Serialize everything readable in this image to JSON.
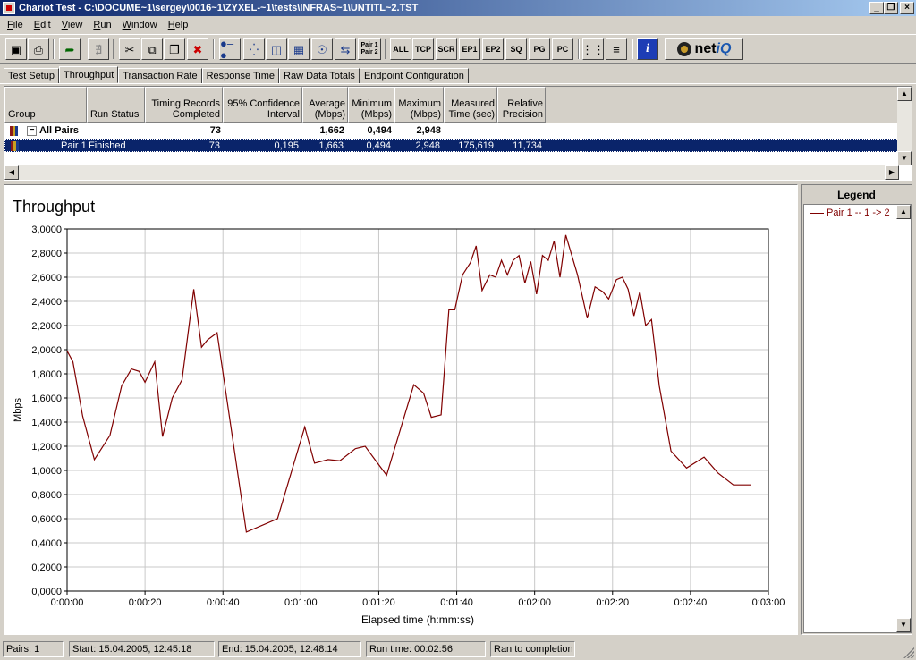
{
  "window": {
    "title": "Chariot Test - C:\\DOCUME~1\\sergey\\0016~1\\ZYXEL-~1\\tests\\INFRAS~1\\UNTITL~2.TST",
    "minimize_label": "_",
    "restore_label": "❐",
    "close_label": "×"
  },
  "menu": [
    {
      "label": "File",
      "key": "F",
      "rest": "ile"
    },
    {
      "label": "Edit",
      "key": "E",
      "rest": "dit"
    },
    {
      "label": "View",
      "key": "V",
      "rest": "iew"
    },
    {
      "label": "Run",
      "key": "R",
      "rest": "un"
    },
    {
      "label": "Window",
      "key": "W",
      "rest": "indow"
    },
    {
      "label": "Help",
      "key": "H",
      "rest": "elp"
    }
  ],
  "toolbar": {
    "save_icon": "save-icon",
    "print_icon": "print-icon",
    "run_icon": "run-icon",
    "pair_label_top": "Pair 1",
    "pair_label_bottom": "Pair 2",
    "all_label": "ALL",
    "tcp_label": "TCP",
    "scr_label": "SCR",
    "ep1_label": "EP1",
    "ep2_label": "EP2",
    "sq_label": "SQ",
    "pg_label": "PG",
    "pc_label": "PC",
    "info_label": "i",
    "brand_net": "net",
    "brand_iq": "iQ"
  },
  "tabs": [
    {
      "label": "Test Setup",
      "active": false
    },
    {
      "label": "Throughput",
      "active": true
    },
    {
      "label": "Transaction Rate",
      "active": false
    },
    {
      "label": "Response Time",
      "active": false
    },
    {
      "label": "Raw Data Totals",
      "active": false
    },
    {
      "label": "Endpoint Configuration",
      "active": false
    }
  ],
  "grid": {
    "headers": {
      "group": "Group",
      "run_status": "Run Status",
      "timing_records": "Timing Records Completed",
      "confidence": "95% Confidence Interval",
      "average": "Average (Mbps)",
      "minimum": "Minimum (Mbps)",
      "maximum": "Maximum (Mbps)",
      "measured_time": "Measured Time (sec)",
      "relative_precision": "Relative Precision"
    },
    "all_pairs": {
      "expander": "−",
      "group": "All Pairs",
      "timing_records": "73",
      "average": "1,662",
      "minimum": "0,494",
      "maximum": "2,948"
    },
    "pair1": {
      "group": "Pair 1",
      "run_status": "Finished",
      "timing_records": "73",
      "confidence": "0,195",
      "average": "1,663",
      "minimum": "0,494",
      "maximum": "2,948",
      "measured_time": "175,619",
      "relative_precision": "11,734"
    }
  },
  "chart": {
    "title": "Throughput",
    "legend_title": "Legend",
    "legend_entry": "Pair 1 -- 1 -> 2"
  },
  "chart_data": {
    "type": "line",
    "title": "Throughput",
    "xlabel": "Elapsed time (h:mm:ss)",
    "ylabel": "Mbps",
    "xlim": [
      0,
      180
    ],
    "ylim": [
      0,
      3
    ],
    "grid": true,
    "legend_placement": "right",
    "x_ticks": [
      {
        "v": 0,
        "label": "0:00:00"
      },
      {
        "v": 20,
        "label": "0:00:20"
      },
      {
        "v": 40,
        "label": "0:00:40"
      },
      {
        "v": 60,
        "label": "0:01:00"
      },
      {
        "v": 80,
        "label": "0:01:20"
      },
      {
        "v": 100,
        "label": "0:01:40"
      },
      {
        "v": 120,
        "label": "0:02:00"
      },
      {
        "v": 140,
        "label": "0:02:20"
      },
      {
        "v": 160,
        "label": "0:02:40"
      },
      {
        "v": 180,
        "label": "0:03:00"
      }
    ],
    "y_ticks": [
      {
        "v": 0,
        "label": "0,0000"
      },
      {
        "v": 0.2,
        "label": "0,2000"
      },
      {
        "v": 0.4,
        "label": "0,4000"
      },
      {
        "v": 0.6,
        "label": "0,6000"
      },
      {
        "v": 0.8,
        "label": "0,8000"
      },
      {
        "v": 1.0,
        "label": "1,0000"
      },
      {
        "v": 1.2,
        "label": "1,2000"
      },
      {
        "v": 1.4,
        "label": "1,4000"
      },
      {
        "v": 1.6,
        "label": "1,6000"
      },
      {
        "v": 1.8,
        "label": "1,8000"
      },
      {
        "v": 2.0,
        "label": "2,0000"
      },
      {
        "v": 2.2,
        "label": "2,2000"
      },
      {
        "v": 2.4,
        "label": "2,4000"
      },
      {
        "v": 2.6,
        "label": "2,6000"
      },
      {
        "v": 2.8,
        "label": "2,8000"
      },
      {
        "v": 3.0,
        "label": "3,0000"
      }
    ],
    "series": [
      {
        "name": "Pair 1 -- 1 -> 2",
        "color": "#800000",
        "points": [
          [
            0,
            1.99
          ],
          [
            1.5,
            1.9
          ],
          [
            4,
            1.45
          ],
          [
            7,
            1.09
          ],
          [
            11,
            1.29
          ],
          [
            14,
            1.7
          ],
          [
            16.5,
            1.84
          ],
          [
            18.5,
            1.82
          ],
          [
            20,
            1.73
          ],
          [
            22.5,
            1.9
          ],
          [
            24.5,
            1.28
          ],
          [
            27,
            1.6
          ],
          [
            29.5,
            1.75
          ],
          [
            32.5,
            2.5
          ],
          [
            34.5,
            2.02
          ],
          [
            36,
            2.08
          ],
          [
            38.5,
            2.14
          ],
          [
            46,
            0.49
          ],
          [
            54,
            0.6
          ],
          [
            61,
            1.36
          ],
          [
            63.5,
            1.06
          ],
          [
            67,
            1.09
          ],
          [
            70,
            1.08
          ],
          [
            74,
            1.18
          ],
          [
            76.5,
            1.2
          ],
          [
            79,
            1.09
          ],
          [
            82,
            0.96
          ],
          [
            89,
            1.71
          ],
          [
            91.5,
            1.64
          ],
          [
            93.5,
            1.44
          ],
          [
            96,
            1.46
          ],
          [
            98,
            2.33
          ],
          [
            99.5,
            2.33
          ],
          [
            101.5,
            2.62
          ],
          [
            103.5,
            2.72
          ],
          [
            105,
            2.86
          ],
          [
            106.5,
            2.49
          ],
          [
            108.5,
            2.62
          ],
          [
            110,
            2.6
          ],
          [
            111.5,
            2.74
          ],
          [
            113,
            2.62
          ],
          [
            114.5,
            2.74
          ],
          [
            116,
            2.78
          ],
          [
            117.5,
            2.55
          ],
          [
            119,
            2.73
          ],
          [
            120.5,
            2.46
          ],
          [
            122,
            2.78
          ],
          [
            123.5,
            2.74
          ],
          [
            125,
            2.9
          ],
          [
            126.5,
            2.6
          ],
          [
            128,
            2.95
          ],
          [
            131,
            2.62
          ],
          [
            133.5,
            2.26
          ],
          [
            135.5,
            2.52
          ],
          [
            137.5,
            2.48
          ],
          [
            139,
            2.42
          ],
          [
            141,
            2.58
          ],
          [
            142.5,
            2.6
          ],
          [
            144,
            2.5
          ],
          [
            145.5,
            2.28
          ],
          [
            147,
            2.48
          ],
          [
            148.5,
            2.2
          ],
          [
            150,
            2.25
          ],
          [
            152,
            1.7
          ],
          [
            155,
            1.16
          ],
          [
            159,
            1.02
          ],
          [
            163.5,
            1.11
          ],
          [
            167,
            0.98
          ],
          [
            171,
            0.88
          ],
          [
            175.5,
            0.88
          ]
        ]
      }
    ]
  },
  "status": {
    "pairs": "Pairs: 1",
    "start": "Start: 15.04.2005, 12:45:18",
    "end": "End: 15.04.2005, 12:48:14",
    "run_time": "Run time: 00:02:56",
    "completion": "Ran to completion"
  }
}
